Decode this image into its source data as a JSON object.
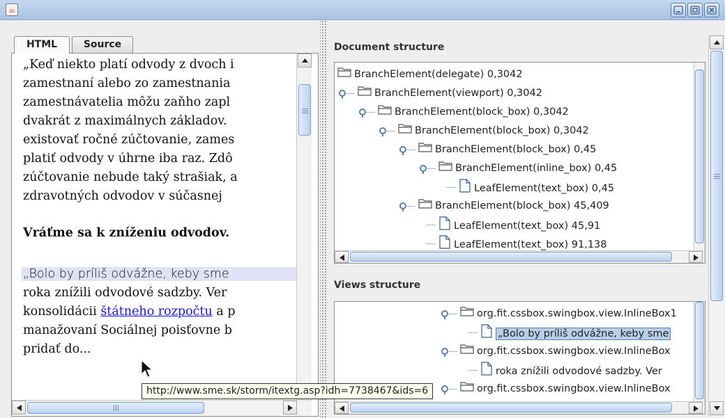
{
  "window": {
    "icon": "java-cup-icon",
    "controls": [
      "minimize-icon",
      "maximize-icon",
      "close-icon"
    ]
  },
  "tabs": [
    {
      "label": "HTML",
      "selected": true
    },
    {
      "label": "Source",
      "selected": false
    }
  ],
  "document": {
    "lines": [
      "„Keď niekto platí odvody z dvoch i",
      "zamestnaní alebo zo zamestnania",
      "zamestnávatelia môžu zaňho zapl",
      "dvakrát z maximálnych základov.",
      "existovať ročné zúčtovanie, zames",
      "platiť odvody v úhrne iba raz. Zdô",
      "zúčtovanie nebude taký strašiak, a",
      "zdravotných odvodov v  súčasnej"
    ],
    "heading": "Vráťme sa k zníženiu odvodov.",
    "quote_line": "„Bolo by príliš odvážne, keby sme",
    "line_after_quote": "roka znížili odvodové sadzby. Ver",
    "link_line_before": "konsolidácii ",
    "link_text": "štátneho rozpočtu",
    "link_line_after": " a p",
    "last_line": "manažovaní Sociálnej poisťovne b",
    "partial_line": "pridať do..."
  },
  "tooltip": "http://www.sme.sk/storm/itextg.asp?idh=7738467&ids=6",
  "document_structure": {
    "title": "Document structure",
    "rows": [
      {
        "label": "BranchElement(delegate) 0,3042",
        "level": 0,
        "type": "folder",
        "toggle": false
      },
      {
        "label": "BranchElement(viewport) 0,3042",
        "level": 1,
        "type": "folder",
        "toggle": true
      },
      {
        "label": "BranchElement(block_box) 0,3042",
        "level": 2,
        "type": "folder",
        "toggle": true
      },
      {
        "label": "BranchElement(block_box) 0,3042",
        "level": 3,
        "type": "folder",
        "toggle": true
      },
      {
        "label": "BranchElement(block_box) 0,45",
        "level": 4,
        "type": "folder",
        "toggle": true
      },
      {
        "label": "BranchElement(inline_box) 0,45",
        "level": 5,
        "type": "folder",
        "toggle": true
      },
      {
        "label": "LeafElement(text_box) 0,45",
        "level": 6,
        "type": "leaf",
        "toggle": false
      },
      {
        "label": "BranchElement(block_box) 45,409",
        "level": 4,
        "type": "folder",
        "toggle": true
      },
      {
        "label": "LeafElement(text_box) 45,91",
        "level": 5,
        "type": "leaf",
        "toggle": false
      },
      {
        "label": "LeafElement(text_box) 91,138",
        "level": 5,
        "type": "leaf",
        "toggle": false
      }
    ]
  },
  "views_structure": {
    "title": "Views structure",
    "rows": [
      {
        "label": "org.fit.cssbox.swingbox.view.InlineBox1",
        "level": 0,
        "type": "folder",
        "toggle": true,
        "selected": false
      },
      {
        "label": "„Bolo by príliš odvážne, keby sme",
        "level": 1,
        "type": "leaf",
        "toggle": false,
        "selected": true
      },
      {
        "label": "org.fit.cssbox.swingbox.view.InlineBox",
        "level": 0,
        "type": "folder",
        "toggle": true,
        "selected": false
      },
      {
        "label": "roka znížili odvodové sadzby. Ver",
        "level": 1,
        "type": "leaf",
        "toggle": false,
        "selected": false
      },
      {
        "label": "org.fit.cssbox.swingbox.view.InlineBox",
        "level": 0,
        "type": "folder",
        "toggle": true,
        "selected": false
      }
    ]
  }
}
